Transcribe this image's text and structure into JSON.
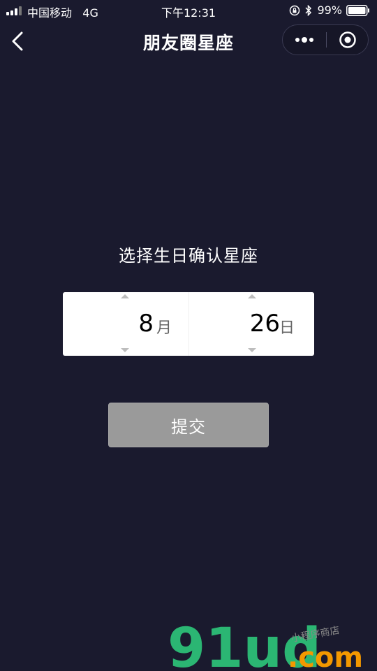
{
  "status_bar": {
    "carrier": "中国移动",
    "network": "4G",
    "time": "下午12:31",
    "battery": "99%"
  },
  "nav": {
    "title": "朋友圈星座",
    "icons": {
      "back": "chevron-left-icon",
      "more": "more-dots-icon",
      "close": "target-close-icon"
    }
  },
  "main": {
    "prompt": "选择生日确认星座",
    "picker": {
      "month_value": "8",
      "month_unit": "月",
      "day_value": "26",
      "day_unit": "日"
    },
    "submit_label": "提交"
  },
  "watermark": {
    "brand": "91ud",
    "domain": ".com",
    "tagline": "小程序商店"
  },
  "colors": {
    "background": "#1a1a2e",
    "picker_bg": "#ffffff",
    "button_bg": "#9a9a9a",
    "watermark_green": "#2bb673",
    "watermark_orange": "#f39800"
  }
}
